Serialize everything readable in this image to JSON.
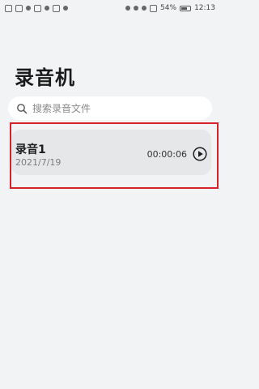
{
  "status_bar": {
    "battery": "54%",
    "time": "12:13"
  },
  "page": {
    "title": "录音机"
  },
  "search": {
    "placeholder": "搜索录音文件"
  },
  "recordings": [
    {
      "name": "录音1",
      "date": "2021/7/19",
      "duration": "00:00:06"
    }
  ],
  "colors": {
    "background": "#f1f3f5",
    "card": "#e6e7e9",
    "highlight_border": "#d8202a"
  }
}
